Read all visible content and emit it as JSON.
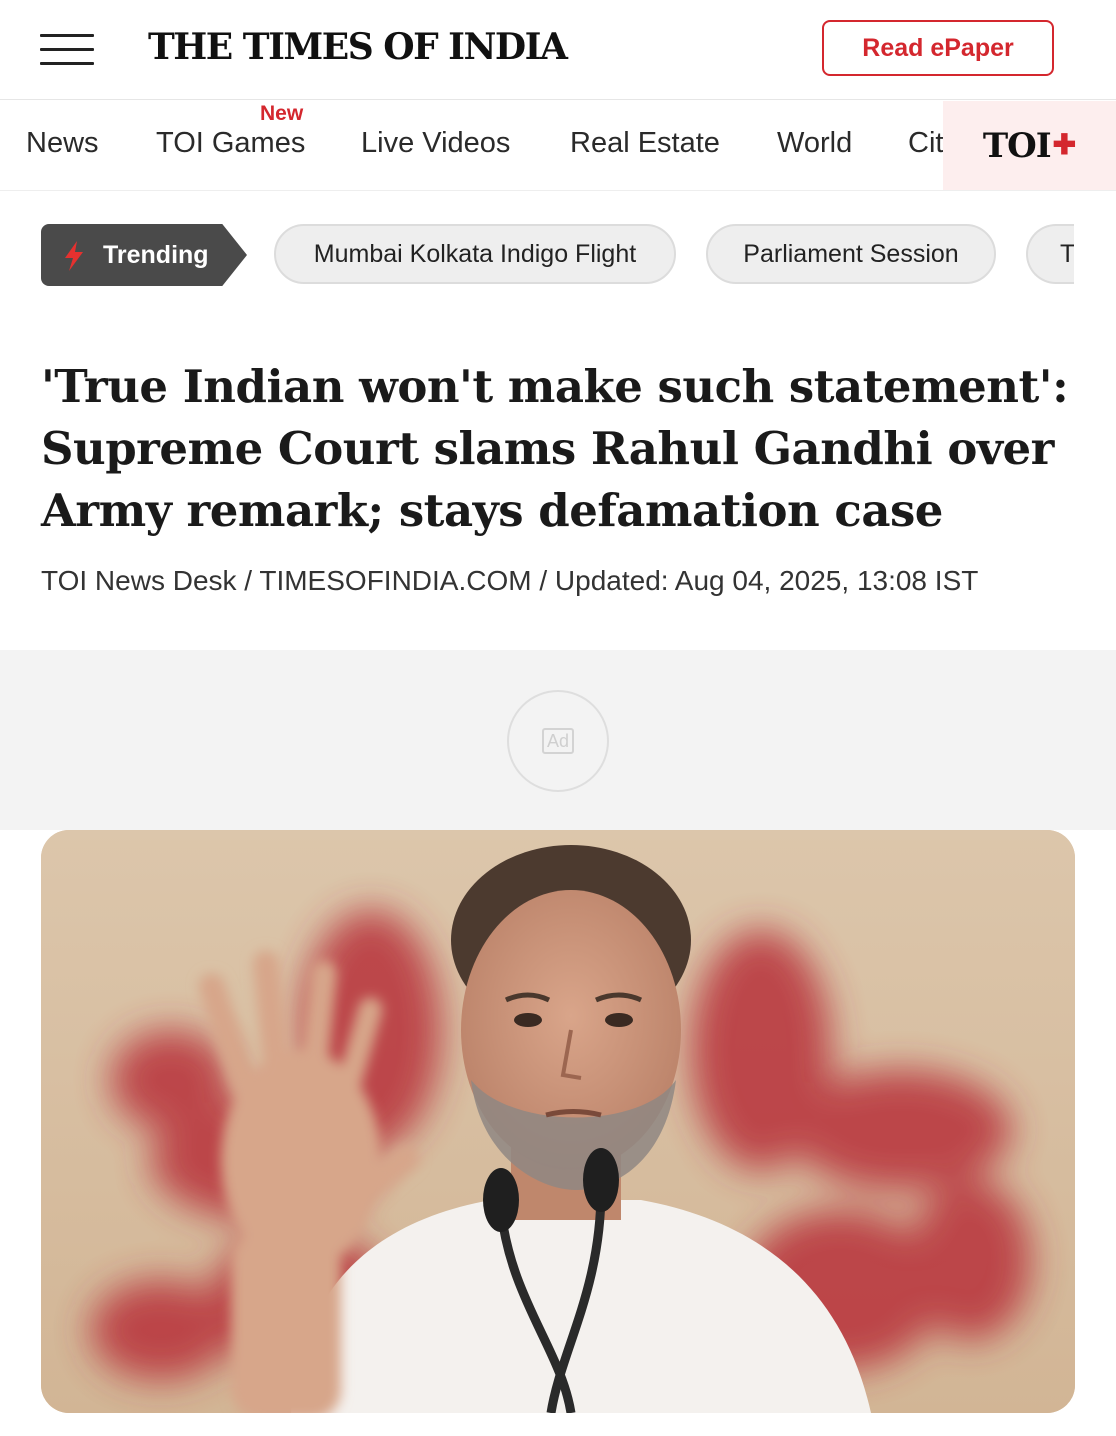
{
  "header": {
    "logo": "THE TIMES OF INDIA",
    "epaper_label": "Read ePaper"
  },
  "nav": {
    "items": [
      {
        "label": "News"
      },
      {
        "label": "TOI Games",
        "badge": "New"
      },
      {
        "label": "Live Videos"
      },
      {
        "label": "Real Estate"
      },
      {
        "label": "World"
      },
      {
        "label": "Cit"
      }
    ],
    "toi_plus": "TOI",
    "toi_plus_mark": "✚"
  },
  "trending": {
    "label": "Trending",
    "chips": [
      "Mumbai Kolkata Indigo Flight",
      "Parliament Session",
      "T"
    ]
  },
  "article": {
    "headline": "'True Indian won't make such statement': Supreme Court slams Rahul Gandhi over Army remark; stays defamation case",
    "byline": "TOI News Desk / TIMESOFINDIA.COM / Updated: Aug 04, 2025, 13:08 IST"
  },
  "ad": {
    "label": "Ad"
  },
  "colors": {
    "accent": "#d4272e",
    "trending_bg": "#4a4a4a",
    "chip_bg": "#eeeeee",
    "toi_plus_bg": "#fdeeee"
  }
}
